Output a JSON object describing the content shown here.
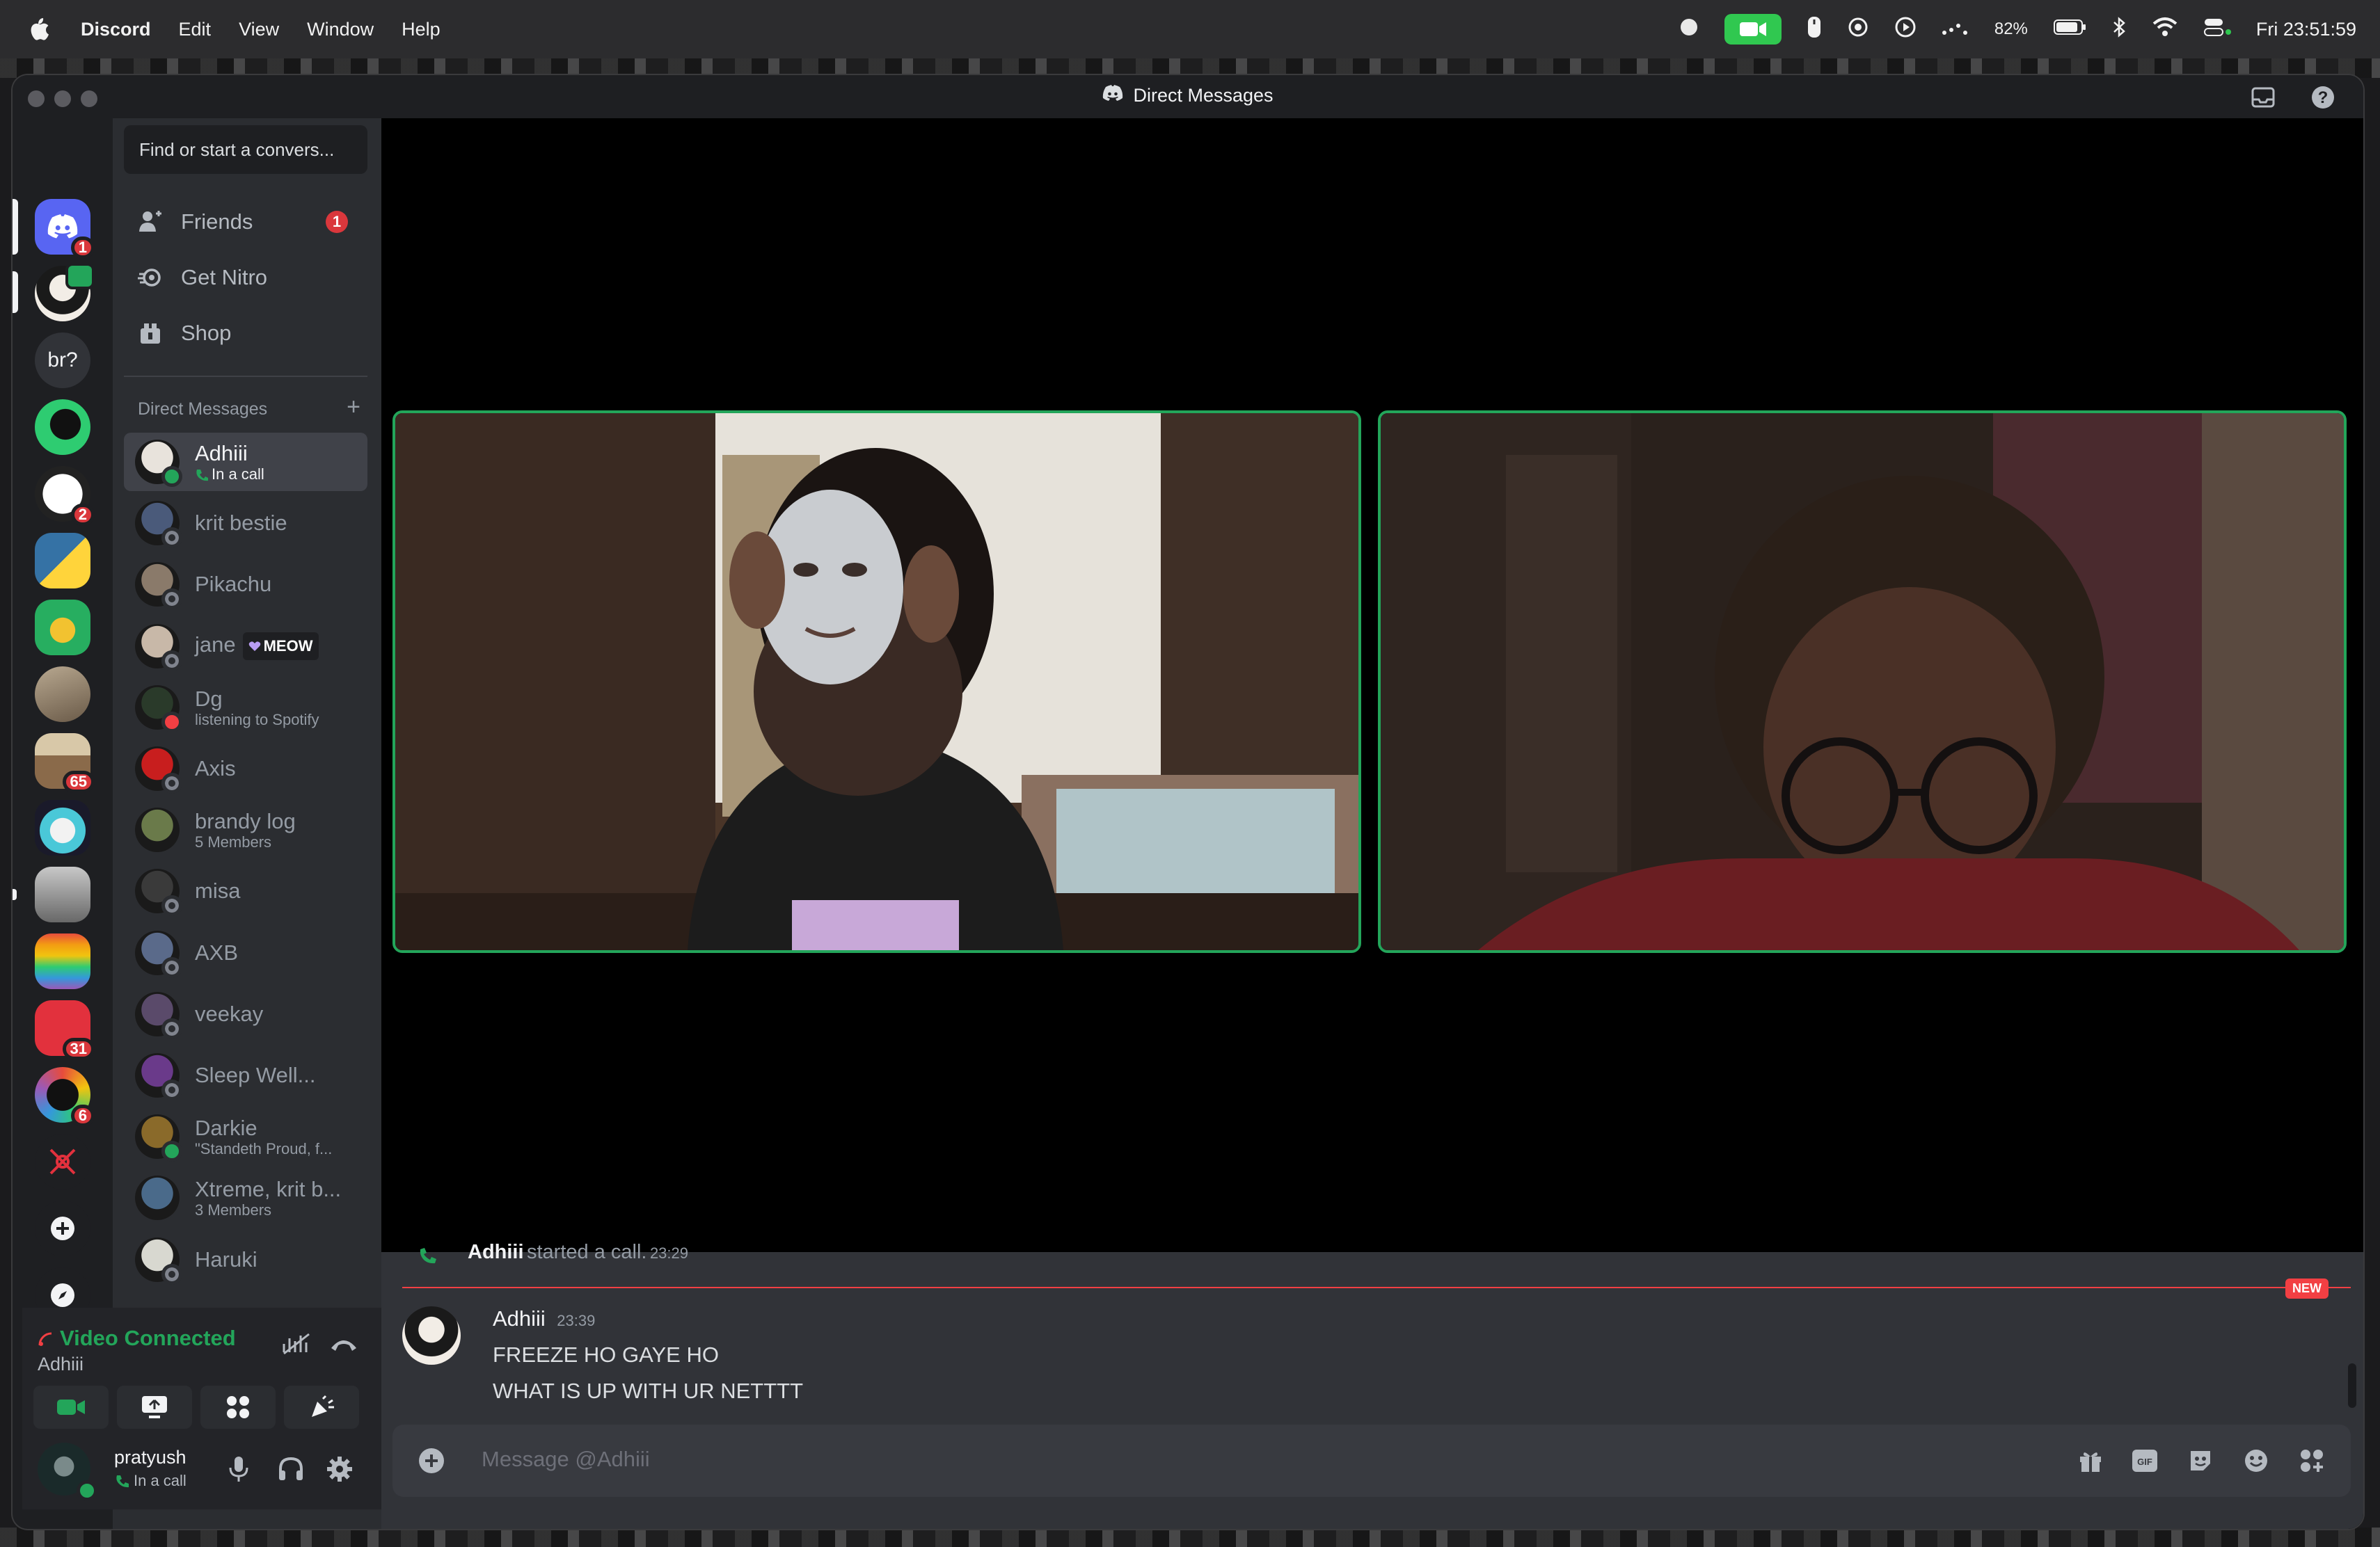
{
  "menubar": {
    "app": "Discord",
    "items": [
      "Edit",
      "View",
      "Window",
      "Help"
    ],
    "battery": "82%",
    "clock": "Fri 23:51:59"
  },
  "window": {
    "title": "Direct Messages"
  },
  "servers": [
    {
      "name": "discord-home",
      "badge": "1"
    },
    {
      "name": "adhiii-dm",
      "badge": ""
    },
    {
      "name": "br?",
      "label": "br?",
      "badge": ""
    },
    {
      "name": "green-server",
      "badge": ""
    },
    {
      "name": "white-server",
      "badge": "2"
    },
    {
      "name": "python-server",
      "badge": ""
    },
    {
      "name": "frog-server",
      "badge": ""
    },
    {
      "name": "photo-server",
      "badge": ""
    },
    {
      "name": "landscape-server",
      "badge": "65"
    },
    {
      "name": "cat-server",
      "badge": ""
    },
    {
      "name": "car-server",
      "badge": ""
    },
    {
      "name": "rainbow-cat-server",
      "badge": ""
    },
    {
      "name": "red-server",
      "badge": "31"
    },
    {
      "name": "ring-server",
      "badge": "6"
    },
    {
      "name": "red-icon-server",
      "badge": ""
    }
  ],
  "sidebar": {
    "search_placeholder": "Find or start a convers...",
    "friends": "Friends",
    "friends_badge": "1",
    "nitro": "Get Nitro",
    "shop": "Shop",
    "dm_header": "Direct Messages",
    "dm_add": "+",
    "dms": [
      {
        "name": "Adhiii",
        "sub": "In a call",
        "status": "on",
        "active": true,
        "color": "#e8e3dc"
      },
      {
        "name": "krit bestie",
        "sub": "",
        "status": "off",
        "color": "#4a5a7a"
      },
      {
        "name": "Pikachu",
        "sub": "",
        "status": "off",
        "color": "#8a7a6a"
      },
      {
        "name": "jane",
        "tag": "MEOW",
        "sub": "",
        "status": "off",
        "color": "#c8b8a8"
      },
      {
        "name": "Dg",
        "sub": "listening to Spotify",
        "status": "dnd",
        "color": "#2a3a2a"
      },
      {
        "name": "Axis",
        "sub": "",
        "status": "off",
        "color": "#c81e1e"
      },
      {
        "name": "brandy log",
        "sub": "5 Members",
        "status": "none",
        "color": "#6a7a4a"
      },
      {
        "name": "misa",
        "sub": "",
        "status": "off",
        "color": "#3a3a3a"
      },
      {
        "name": "AXB",
        "sub": "",
        "status": "off",
        "color": "#5a6a8a"
      },
      {
        "name": "veekay",
        "sub": "",
        "status": "off",
        "color": "#5a4a6a"
      },
      {
        "name": "Sleep Well...",
        "sub": "",
        "status": "off",
        "color": "#6a3a8a"
      },
      {
        "name": "Darkie",
        "sub": "\"Standeth Proud, f...",
        "status": "on",
        "color": "#8a6a2a"
      },
      {
        "name": "Xtreme, krit b...",
        "sub": "3 Members",
        "status": "none",
        "color": "#4a6a8a"
      },
      {
        "name": "Haruki",
        "sub": "",
        "status": "off",
        "color": "#d8d8d0"
      }
    ]
  },
  "voice": {
    "title": "Video Connected",
    "channel": "Adhiii"
  },
  "user": {
    "name": "pratyush",
    "status": "In a call"
  },
  "chat": {
    "system_name": "Adhiii",
    "system_text": "started a call.",
    "system_time": "23:29",
    "new_label": "NEW",
    "author": "Adhiii",
    "time": "23:39",
    "lines": [
      "FREEZE HO GAYE HO",
      "WHAT IS UP WITH UR NETTTT"
    ],
    "placeholder": "Message @Adhiii"
  },
  "colors": {
    "accent_green": "#23a55a",
    "blurple": "#5865f2",
    "danger": "#da373c"
  }
}
